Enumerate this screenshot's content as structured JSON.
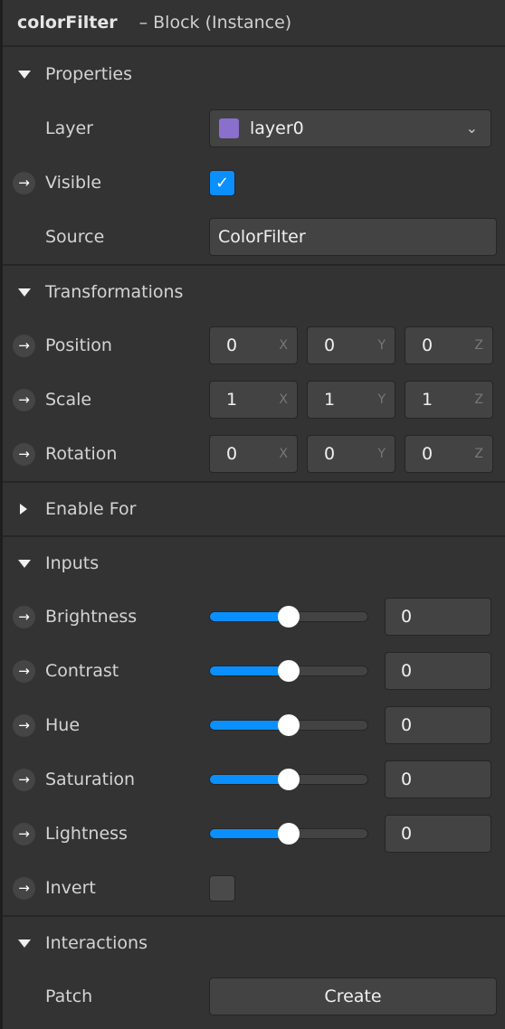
{
  "header": {
    "name": "colorFilter",
    "kind": "– Block (Instance)"
  },
  "colors": {
    "accent": "#0a8fff",
    "layer_swatch": "#8a6fcc"
  },
  "icons": {
    "expanded": "triangle-down-icon",
    "collapsed": "triangle-right-icon",
    "connect": "arrow-right-icon",
    "dropdown": "chevron-down-icon",
    "check": "checkmark-icon"
  },
  "sections": {
    "properties": {
      "title": "Properties",
      "layer_label": "Layer",
      "layer_value": "layer0",
      "visible_label": "Visible",
      "visible_checked": true,
      "source_label": "Source",
      "source_value": "ColorFilter"
    },
    "transformations": {
      "title": "Transformations",
      "position": {
        "label": "Position",
        "x": "0",
        "y": "0",
        "z": "0"
      },
      "scale": {
        "label": "Scale",
        "x": "1",
        "y": "1",
        "z": "1"
      },
      "rotation": {
        "label": "Rotation",
        "x": "0",
        "y": "0",
        "z": "0"
      },
      "axes": {
        "x": "X",
        "y": "Y",
        "z": "Z"
      }
    },
    "enable_for": {
      "title": "Enable For",
      "expanded": false
    },
    "inputs": {
      "title": "Inputs",
      "sliders": [
        {
          "label": "Brightness",
          "value": "0",
          "fraction": 0.5
        },
        {
          "label": "Contrast",
          "value": "0",
          "fraction": 0.5
        },
        {
          "label": "Hue",
          "value": "0",
          "fraction": 0.5
        },
        {
          "label": "Saturation",
          "value": "0",
          "fraction": 0.5
        },
        {
          "label": "Lightness",
          "value": "0",
          "fraction": 0.5
        }
      ],
      "invert_label": "Invert",
      "invert_checked": false
    },
    "interactions": {
      "title": "Interactions",
      "patch_label": "Patch",
      "create_label": "Create"
    }
  }
}
